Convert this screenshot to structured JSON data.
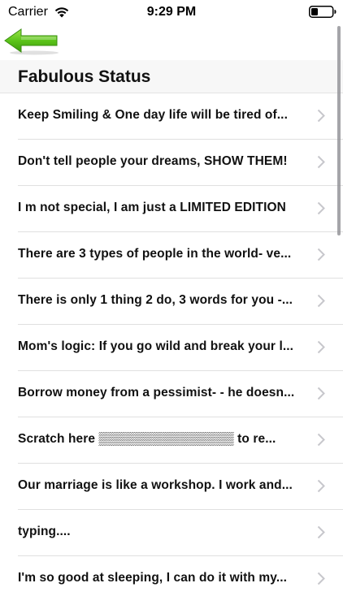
{
  "status_bar": {
    "carrier": "Carrier",
    "time": "9:29 PM"
  },
  "nav": {
    "back_icon": "green-arrow-left-icon",
    "accent_color": "#5cc41a"
  },
  "section": {
    "title": "Fabulous Status"
  },
  "items": [
    {
      "text": "Keep Smiling & One day life will be tired of..."
    },
    {
      "text": "Don't tell people your dreams, SHOW THEM!"
    },
    {
      "text": "I m not special, I am just a LIMITED EDITION"
    },
    {
      "text": "There are 3 types of people in the world- ve..."
    },
    {
      "text": "There is only 1 thing 2 do, 3 words for you -..."
    },
    {
      "text": "Mom's logic: If you go wild and break your l..."
    },
    {
      "text": "Borrow money from a pessimist- - he doesn..."
    },
    {
      "text": "Scratch here ▒▒▒▒▒▒▒▒▒▒▒▒▒▒▒ to re..."
    },
    {
      "text": "Our marriage is like a workshop. I work and..."
    },
    {
      "text": "typing...."
    },
    {
      "text": "I'm so good at sleeping, I can do it with my..."
    }
  ]
}
